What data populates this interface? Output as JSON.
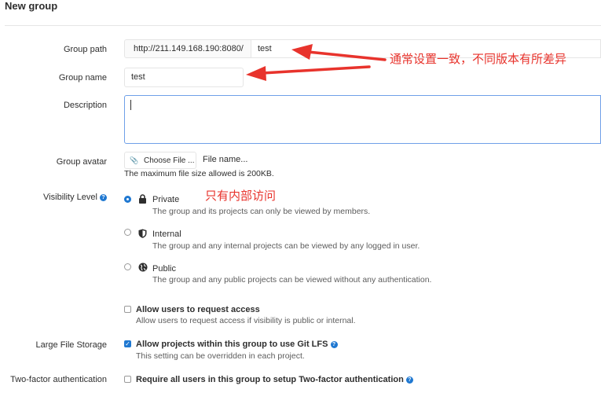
{
  "page": {
    "title": "New group"
  },
  "form": {
    "group_path": {
      "label": "Group path",
      "prefix": "http://211.149.168.190:8080/",
      "value": "test"
    },
    "group_name": {
      "label": "Group name",
      "value": "test"
    },
    "description": {
      "label": "Description",
      "value": ""
    },
    "group_avatar": {
      "label": "Group avatar",
      "button_label": "Choose File ...",
      "file_name": "File name...",
      "help": "The maximum file size allowed is 200KB."
    },
    "visibility": {
      "label": "Visibility Level",
      "options": [
        {
          "name": "Private",
          "desc": "The group and its projects can only be viewed by members.",
          "selected": true,
          "icon": "lock-icon"
        },
        {
          "name": "Internal",
          "desc": "The group and any internal projects can be viewed by any logged in user.",
          "selected": false,
          "icon": "shield-icon"
        },
        {
          "name": "Public",
          "desc": "The group and any public projects can be viewed without any authentication.",
          "selected": false,
          "icon": "globe-icon"
        }
      ]
    },
    "request_access": {
      "label": "Allow users to request access",
      "help": "Allow users to request access if visibility is public or internal.",
      "checked": false
    },
    "lfs": {
      "section_label": "Large File Storage",
      "label": "Allow projects within this group to use Git LFS",
      "help": "This setting can be overridden in each project.",
      "checked": true
    },
    "two_factor": {
      "section_label": "Two-factor authentication",
      "label": "Require all users in this group to setup Two-factor authentication",
      "checked": false
    }
  },
  "annotations": {
    "path_note": "通常设置一致，不同版本有所差异",
    "visibility_note": "只有内部访问"
  },
  "colors": {
    "accent": "#1f78d1",
    "annotation": "#e8332c"
  }
}
